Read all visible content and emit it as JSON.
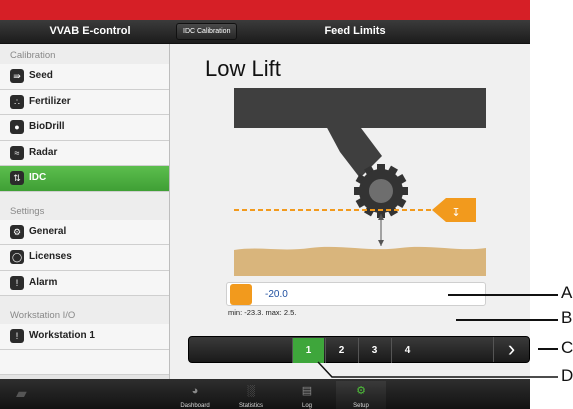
{
  "app": {
    "title": "VVAB E-control"
  },
  "header": {
    "back_label": "IDC Calibration",
    "title": "Feed Limits"
  },
  "sidebar": {
    "sections": [
      {
        "title": "Calibration",
        "items": [
          {
            "label": "Seed",
            "icon": "seed-icon"
          },
          {
            "label": "Fertilizer",
            "icon": "fertilizer-icon"
          },
          {
            "label": "BioDrill",
            "icon": "biodrill-icon"
          },
          {
            "label": "Radar",
            "icon": "radar-icon"
          },
          {
            "label": "IDC",
            "icon": "idc-icon",
            "active": true
          }
        ]
      },
      {
        "title": "Settings",
        "items": [
          {
            "label": "General",
            "icon": "general-icon"
          },
          {
            "label": "Licenses",
            "icon": "licenses-icon"
          },
          {
            "label": "Alarm",
            "icon": "alarm-icon"
          }
        ]
      },
      {
        "title": "Workstation I/O",
        "items": [
          {
            "label": "Workstation 1",
            "icon": "workstation-icon"
          }
        ]
      }
    ]
  },
  "main": {
    "heading": "Low Lift",
    "value": "-20.0",
    "minmax": "min: -23.3. max: 2.5."
  },
  "steps": [
    "1",
    "2",
    "3",
    "4"
  ],
  "active_step": "1",
  "callouts": [
    "A",
    "B",
    "C",
    "D"
  ],
  "tabs": [
    {
      "label": "Dashboard",
      "icon": "dashboard-icon"
    },
    {
      "label": "Statistics",
      "icon": "statistics-icon"
    },
    {
      "label": "Log",
      "icon": "log-icon"
    },
    {
      "label": "Setup",
      "icon": "setup-icon",
      "active": true
    }
  ],
  "colors": {
    "brand_red": "#d61f26",
    "active_green": "#3ea63b",
    "accent_orange": "#f29a1d",
    "soil": "#d9b57c",
    "value_blue": "#1f4fa0"
  }
}
